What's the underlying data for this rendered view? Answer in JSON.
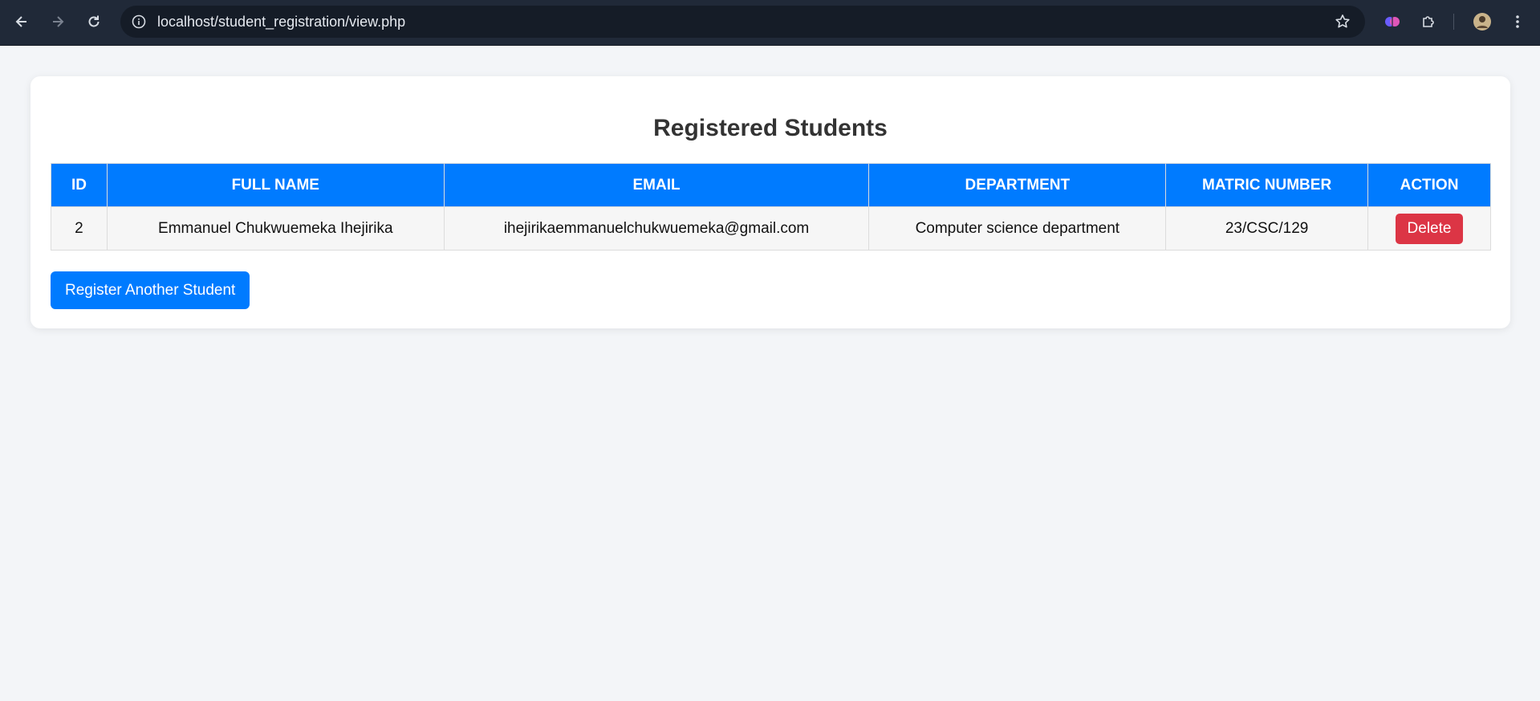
{
  "browser": {
    "url": "localhost/student_registration/view.php",
    "icons": [
      "back-arrow-icon",
      "forward-arrow-icon",
      "reload-icon",
      "site-info-icon",
      "bookmark-star-icon",
      "brain-extension-icon",
      "extensions-puzzle-icon",
      "profile-avatar",
      "menu-kebab-icon"
    ]
  },
  "page": {
    "title": "Registered Students",
    "table": {
      "headers": [
        "ID",
        "FULL NAME",
        "EMAIL",
        "DEPARTMENT",
        "MATRIC NUMBER",
        "ACTION"
      ],
      "rows": [
        {
          "id": "2",
          "full_name": "Emmanuel Chukwuemeka Ihejirika",
          "email": "ihejirikaemmanuelchukwuemeka@gmail.com",
          "department": "Computer science department",
          "matric_number": "23/CSC/129",
          "action_label": "Delete"
        }
      ]
    },
    "register_button_label": "Register Another Student"
  },
  "colors": {
    "primary": "#007bff",
    "danger": "#dc3545",
    "background": "#f3f5f8",
    "chrome": "#202938"
  }
}
